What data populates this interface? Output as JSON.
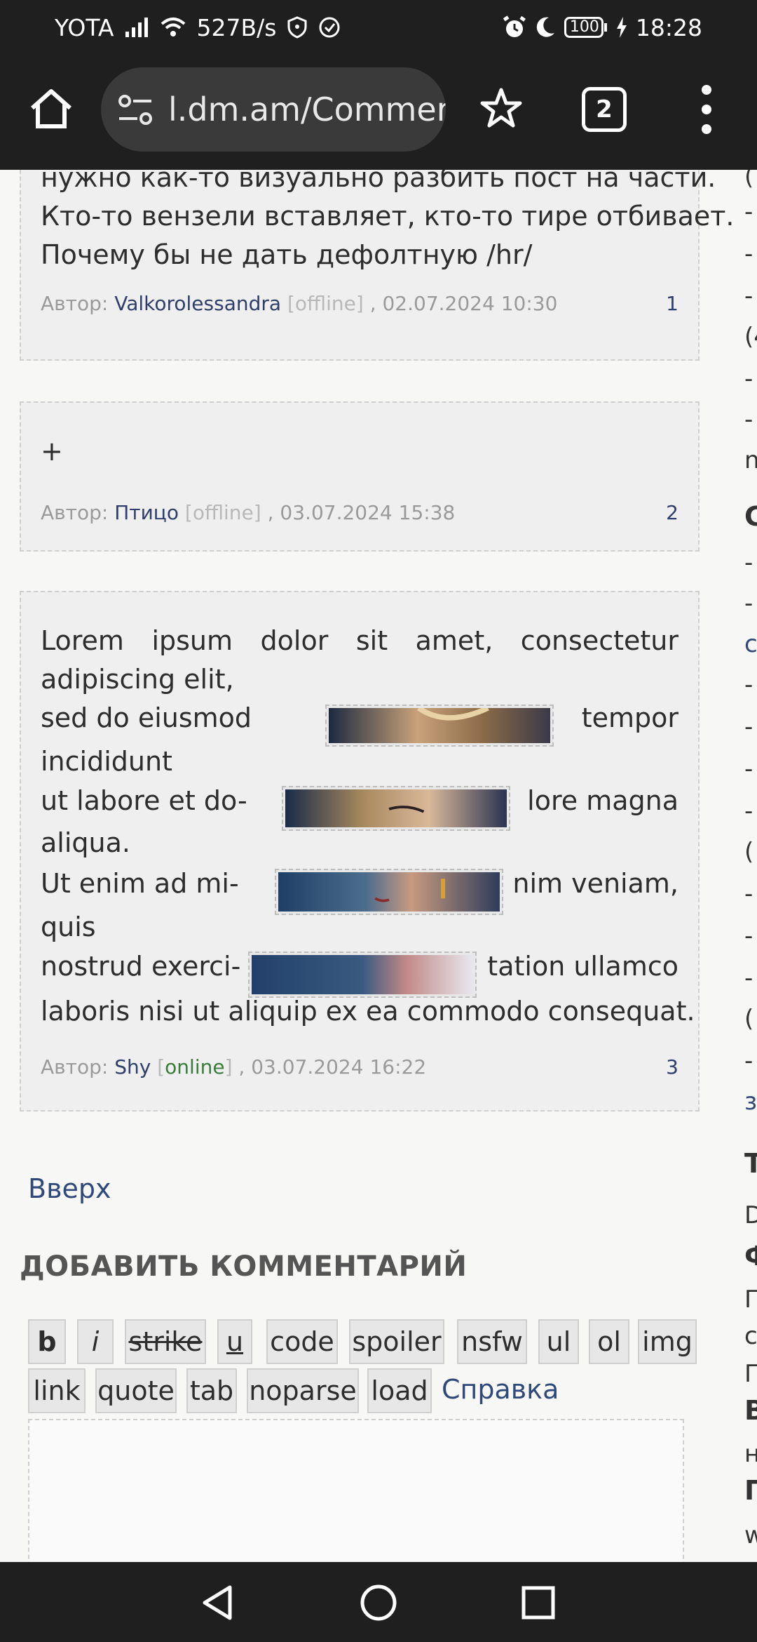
{
  "status_bar": {
    "carrier": "YOTA",
    "speed": "527B/s",
    "battery": "100",
    "time": "18:28"
  },
  "browser": {
    "url": "l.dm.am/Commer",
    "tab_count": "2"
  },
  "posts": [
    {
      "lines": [
        "нужно как-то визуально разбить пост на части.",
        "Кто-то вензели вставляет, кто-то тире отбивает.",
        "Почему бы не дать дефолтную /hr/"
      ],
      "author_prefix": "Автор:",
      "author": "Valkorolessandra",
      "status": "offline",
      "date": ", 02.07.2024 10:30",
      "number": "1"
    },
    {
      "lines": [
        "+"
      ],
      "author_prefix": "Автор:",
      "author": "Птицо",
      "status": "offline",
      "date": ", 03.07.2024 15:38",
      "number": "2"
    },
    {
      "lines": [
        "Lorem ipsum dolor sit amet, consectetur",
        "adipiscing elit,",
        "sed do eiusmod",
        "tempor",
        "incididunt",
        "ut labore et do-",
        "lore magna",
        "aliqua.",
        "Ut enim ad mi-",
        "nim veniam,",
        "quis",
        "nostrud exerci-",
        "tation ullamco",
        "laboris nisi ut aliquip ex ea commodo consequat."
      ],
      "author_prefix": "Автор:",
      "author": "Shy",
      "status": "online",
      "date": ", 03.07.2024 16:22",
      "number": "3"
    }
  ],
  "up_link": "Вверх",
  "add_comment_title": "ДОБАВИТЬ КОММЕНТАРИЙ",
  "bbcode_buttons": [
    "b",
    "i",
    "strike",
    "u",
    "code",
    "spoiler",
    "nsfw",
    "ul",
    "ol",
    "img",
    "link",
    "quote",
    "tab",
    "noparse",
    "load"
  ],
  "help_link": "Справка",
  "sidebar_fragments": [
    "(",
    "-",
    "-",
    "-",
    "(4",
    "-",
    "-",
    "n",
    "C",
    "-",
    "-",
    "c",
    "-",
    "-",
    "-",
    "-",
    "(",
    "-",
    "-",
    "-",
    "(",
    "-",
    "з",
    "T",
    "D",
    "Ф",
    "П",
    "c",
    "П",
    "B",
    "н",
    "П",
    "w"
  ],
  "colors": {
    "chrome": "#1f1f1f",
    "link": "#2f4a7a",
    "online": "#3a7d3a",
    "post_bg": "#efefef"
  }
}
